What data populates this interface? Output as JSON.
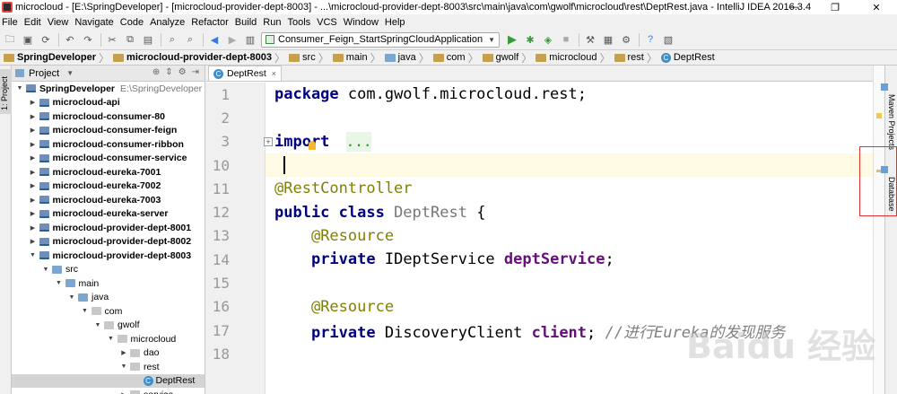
{
  "window": {
    "title": "microcloud - [E:\\SpringDeveloper] - [microcloud-provider-dept-8003] - ...\\microcloud-provider-dept-8003\\src\\main\\java\\com\\gwolf\\microcloud\\rest\\DeptRest.java - IntelliJ IDEA 2016.3.4",
    "controls": {
      "minimize": "—",
      "restore": "❐",
      "close": "✕"
    }
  },
  "menu": [
    "File",
    "Edit",
    "View",
    "Navigate",
    "Code",
    "Analyze",
    "Refactor",
    "Build",
    "Run",
    "Tools",
    "VCS",
    "Window",
    "Help"
  ],
  "toolbar": {
    "run_config": "Consumer_Feign_StartSpringCloudApplication"
  },
  "breadcrumbs": [
    "SpringDeveloper",
    "microcloud-provider-dept-8003",
    "src",
    "main",
    "java",
    "com",
    "gwolf",
    "microcloud",
    "rest",
    "DeptRest"
  ],
  "left_tool_window": {
    "label": "1: Project"
  },
  "project_panel": {
    "title": "Project",
    "tree": [
      {
        "label": "SpringDeveloper",
        "path": "E:\\SpringDeveloper",
        "depth": 0,
        "expanded": true,
        "icon": "module-icon"
      },
      {
        "label": "microcloud-api",
        "depth": 1,
        "expanded": false,
        "icon": "module-icon"
      },
      {
        "label": "microcloud-consumer-80",
        "depth": 1,
        "expanded": false,
        "icon": "module-icon"
      },
      {
        "label": "microcloud-consumer-feign",
        "depth": 1,
        "expanded": false,
        "icon": "module-icon"
      },
      {
        "label": "microcloud-consumer-ribbon",
        "depth": 1,
        "expanded": false,
        "icon": "module-icon"
      },
      {
        "label": "microcloud-consumer-service",
        "depth": 1,
        "expanded": false,
        "icon": "module-icon"
      },
      {
        "label": "microcloud-eureka-7001",
        "depth": 1,
        "expanded": false,
        "icon": "module-icon"
      },
      {
        "label": "microcloud-eureka-7002",
        "depth": 1,
        "expanded": false,
        "icon": "module-icon"
      },
      {
        "label": "microcloud-eureka-7003",
        "depth": 1,
        "expanded": false,
        "icon": "module-icon"
      },
      {
        "label": "microcloud-eureka-server",
        "depth": 1,
        "expanded": false,
        "icon": "module-icon"
      },
      {
        "label": "microcloud-provider-dept-8001",
        "depth": 1,
        "expanded": false,
        "icon": "module-icon"
      },
      {
        "label": "microcloud-provider-dept-8002",
        "depth": 1,
        "expanded": false,
        "icon": "module-icon"
      },
      {
        "label": "microcloud-provider-dept-8003",
        "depth": 1,
        "expanded": true,
        "icon": "module-icon"
      },
      {
        "label": "src",
        "depth": 2,
        "expanded": true,
        "icon": "folder-icon"
      },
      {
        "label": "main",
        "depth": 3,
        "expanded": true,
        "icon": "folder-icon"
      },
      {
        "label": "java",
        "depth": 4,
        "expanded": true,
        "icon": "source-folder-icon"
      },
      {
        "label": "com",
        "depth": 5,
        "expanded": true,
        "icon": "package-icon"
      },
      {
        "label": "gwolf",
        "depth": 6,
        "expanded": true,
        "icon": "package-icon"
      },
      {
        "label": "microcloud",
        "depth": 7,
        "expanded": true,
        "icon": "package-icon"
      },
      {
        "label": "dao",
        "depth": 8,
        "expanded": false,
        "icon": "package-icon"
      },
      {
        "label": "rest",
        "depth": 8,
        "expanded": true,
        "icon": "package-icon"
      },
      {
        "label": "DeptRest",
        "depth": 9,
        "expanded": null,
        "icon": "class-icon",
        "selected": true
      },
      {
        "label": "service",
        "depth": 8,
        "expanded": false,
        "icon": "package-icon"
      }
    ]
  },
  "editor": {
    "tab_label": "DeptRest",
    "tab_close": "×",
    "lines": [
      {
        "num": "1",
        "tokens": [
          {
            "t": "package ",
            "c": "kw"
          },
          {
            "t": "com.gwolf.microcloud.rest;",
            "c": ""
          }
        ]
      },
      {
        "num": "2",
        "tokens": []
      },
      {
        "num": "3",
        "tokens": [
          {
            "t": "import ",
            "c": "kw"
          },
          {
            "t": "...",
            "c": "fold"
          }
        ]
      },
      {
        "num": "10",
        "tokens": [],
        "current": true
      },
      {
        "num": "11",
        "tokens": [
          {
            "t": "@RestController",
            "c": "ann"
          }
        ]
      },
      {
        "num": "12",
        "tokens": [
          {
            "t": "public class ",
            "c": "kw"
          },
          {
            "t": "DeptRest",
            "c": "gray"
          },
          {
            "t": " {",
            "c": ""
          }
        ]
      },
      {
        "num": "13",
        "tokens": [
          {
            "t": "    ",
            "c": ""
          },
          {
            "t": "@Resource",
            "c": "ann"
          }
        ]
      },
      {
        "num": "14",
        "tokens": [
          {
            "t": "    ",
            "c": ""
          },
          {
            "t": "private ",
            "c": "kw"
          },
          {
            "t": "IDeptService ",
            "c": ""
          },
          {
            "t": "deptService",
            "c": "fld"
          },
          {
            "t": ";",
            "c": ""
          }
        ]
      },
      {
        "num": "15",
        "tokens": []
      },
      {
        "num": "16",
        "tokens": [
          {
            "t": "    ",
            "c": ""
          },
          {
            "t": "@Resource",
            "c": "ann"
          }
        ]
      },
      {
        "num": "17",
        "tokens": [
          {
            "t": "    ",
            "c": ""
          },
          {
            "t": "private ",
            "c": "kw"
          },
          {
            "t": "DiscoveryClient ",
            "c": ""
          },
          {
            "t": "client",
            "c": "fld"
          },
          {
            "t": "; ",
            "c": ""
          },
          {
            "t": "//进行Eureka的发现服务",
            "c": "cmt"
          }
        ]
      },
      {
        "num": "18",
        "tokens": []
      }
    ]
  },
  "right_tool_windows": [
    "Maven Projects",
    "Database"
  ],
  "watermark": "Baidu 经验",
  "colors": {
    "keyword": "#000080",
    "annotation": "#808000",
    "field": "#660e7a",
    "comment": "#808080",
    "highlight_box": "#e0332e"
  }
}
